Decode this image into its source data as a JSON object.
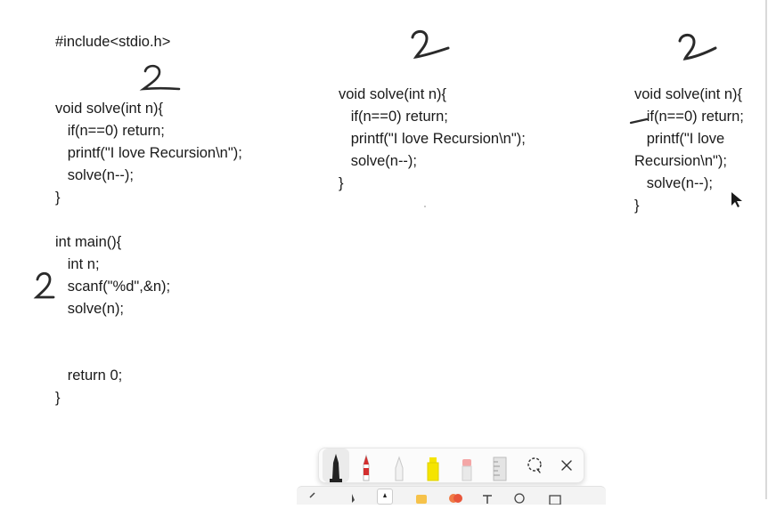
{
  "code_main": {
    "lines": [
      "#include<stdio.h>",
      "",
      "",
      "void solve(int n){",
      "   if(n==0) return;",
      "   printf(\"I love Recursion\\n\");",
      "   solve(n--);",
      "}",
      "",
      "int main(){",
      "   int n;",
      "   scanf(\"%d\",&n);",
      "   solve(n);",
      "",
      "",
      "   return 0;",
      "}"
    ]
  },
  "code_middle": {
    "lines": [
      "void solve(int n){",
      "   if(n==0) return;",
      "   printf(\"I love Recursion\\n\");",
      "   solve(n--);",
      "}"
    ]
  },
  "code_right": {
    "lines": [
      "void solve(int n){",
      "   if(n==0) return;",
      "   printf(\"I love",
      "Recursion\\n\");",
      "   solve(n--);",
      "}"
    ]
  },
  "annotations": {
    "handwritten_digit": "2",
    "ink_color": "#2a2a2a"
  },
  "pen_toolbar": {
    "tools": [
      {
        "icon": "ballpoint-pen-icon",
        "color": "#222222",
        "selected": true
      },
      {
        "icon": "red-pen-icon",
        "color": "#d32f2f",
        "selected": false
      },
      {
        "icon": "pencil-icon",
        "color": "#cfcfcf",
        "selected": false
      },
      {
        "icon": "highlighter-icon",
        "color": "#f5e400",
        "selected": false
      },
      {
        "icon": "eraser-icon",
        "color": "#f4a6a6",
        "selected": false
      },
      {
        "icon": "ruler-icon",
        "color": "#bdbdbd",
        "selected": false
      }
    ],
    "lasso_icon": "lasso-select-icon",
    "close_icon": "close-icon"
  }
}
